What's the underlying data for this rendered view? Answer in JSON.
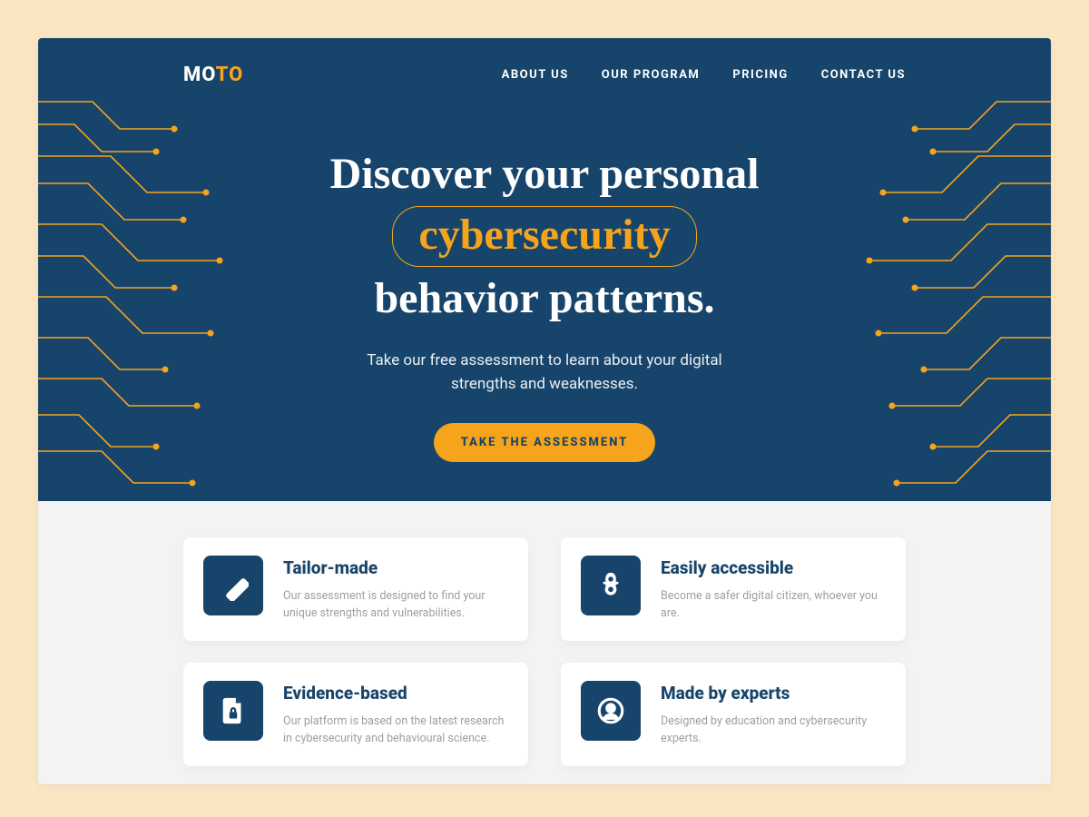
{
  "colors": {
    "hero_bg": "#17446a",
    "accent": "#f6a41c",
    "page_bg": "#f3f3f3",
    "body_bg": "#fae6c3"
  },
  "logo": {
    "part_a": "MO",
    "part_b": "TO"
  },
  "nav": [
    "ABOUT US",
    "OUR PROGRAM",
    "PRICING",
    "CONTACT US"
  ],
  "hero": {
    "title_line1": "Discover your personal",
    "title_highlight": "cybersecurity",
    "title_line3": "behavior patterns.",
    "subtitle_line1": "Take our free assessment to learn about your digital",
    "subtitle_line2": "strengths and weaknesses.",
    "cta": "TAKE THE ASSESSMENT"
  },
  "features": [
    {
      "icon": "ruler-icon",
      "title": "Tailor-made",
      "desc": "Our assessment is designed to find your unique strengths and vulnerabilities."
    },
    {
      "icon": "lock-icon",
      "title": "Easily accessible",
      "desc": "Become a safer digital citizen, whoever you are."
    },
    {
      "icon": "file-lock-icon",
      "title": "Evidence-based",
      "desc": "Our platform is based on the latest research in cybersecurity and behavioural science."
    },
    {
      "icon": "user-circle-icon",
      "title": "Made by experts",
      "desc": "Designed by education and cybersecurity experts."
    }
  ]
}
